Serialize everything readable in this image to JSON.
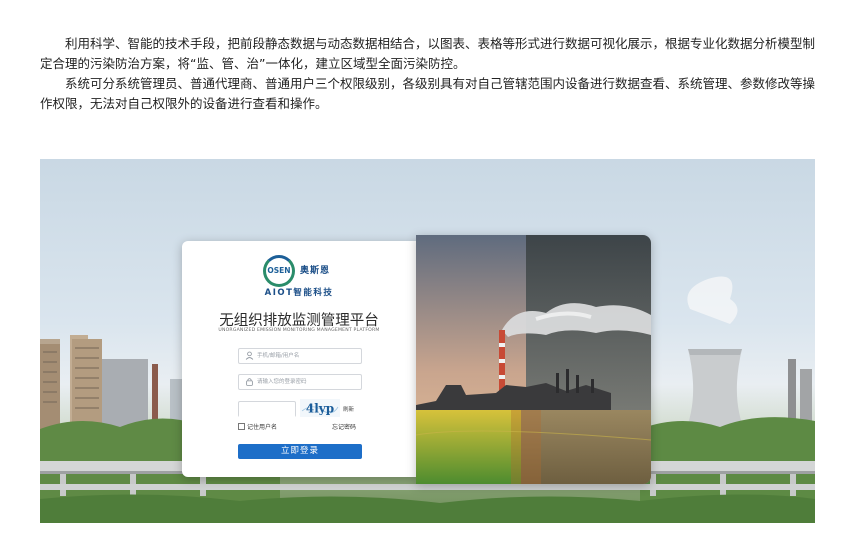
{
  "intro": {
    "paragraph1": "利用科学、智能的技术手段，把前段静态数据与动态数据相结合，以图表、表格等形式进行数据可视化展示，根据专业化数据分析模型制定合理的污染防治方案，将“监、管、治”一体化，建立区域型全面污染防控。",
    "paragraph2": "系统可分系统管理员、普通代理商、普通用户三个权限级别，各级别具有对自己管辖范围内设备进行数据查看、系统管理、参数修改等操作权限，无法对自己权限外的设备进行查看和操作。"
  },
  "login": {
    "logo_ring_text": "OSEN",
    "logo_cn": "奥斯恩",
    "logo_sub": "AIOT智能科技",
    "title": "无组织排放监测管理平台",
    "subtitle": "UNORGANIZED EMISSION MONITORING MANAGEMENT PLATFORM",
    "username_placeholder": "手机/邮箱/用户名",
    "password_placeholder": "请输入您的登录密码",
    "captcha_text": "4lyp",
    "refresh_label": "刷新",
    "remember_label": "记住用户名",
    "forgot_label": "忘记密码",
    "login_button": "立即登录"
  },
  "colors": {
    "primary": "#1d6ec8",
    "brand_blue": "#1c4f88",
    "brand_green": "#2a8c6a"
  },
  "icons": {
    "username": "user-icon",
    "password": "lock-icon"
  }
}
